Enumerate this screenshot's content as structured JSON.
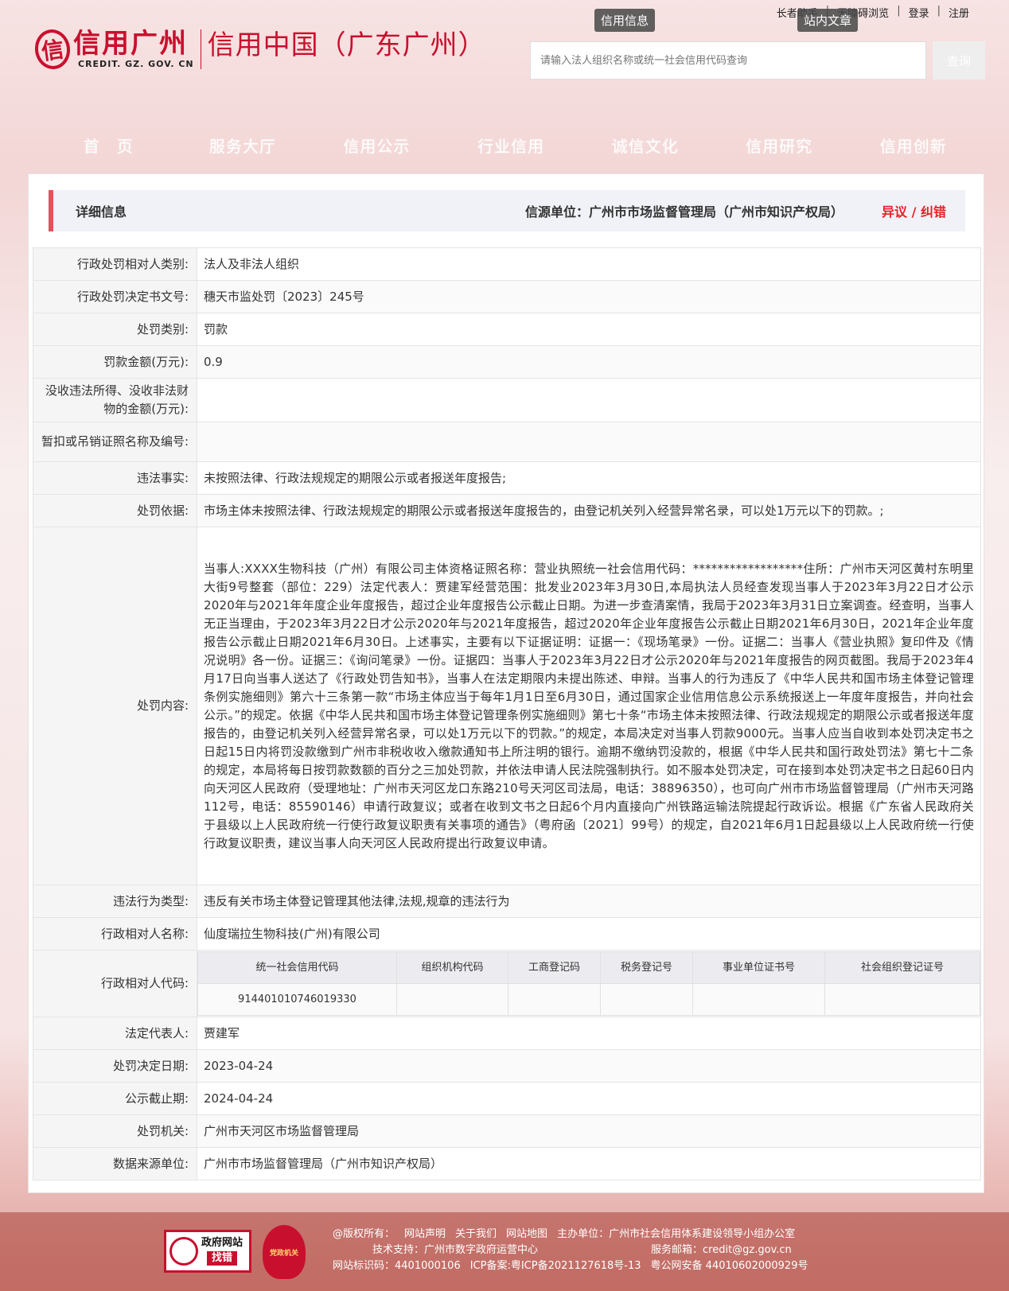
{
  "header": {
    "logo_cn": "信用广州",
    "logo_en": "CREDIT. GZ. GOV. CN",
    "site_title": "信用中国（广东广州）",
    "top_links": [
      "长者助手",
      "无障碍浏览",
      "登录",
      "注册"
    ],
    "tab_credit_info": "信用信息",
    "tab_site_article": "站内文章",
    "search_placeholder": "请输入法人组织名称或统一社会信用代码查询",
    "search_button": "查询"
  },
  "nav": [
    "首　页",
    "服务大厅",
    "信用公示",
    "行业信用",
    "诚信文化",
    "信用研究",
    "信用创新"
  ],
  "detail": {
    "title": "详细信息",
    "source": "信源单位：广州市市场监督管理局（广州市知识产权局）",
    "objection": "异议 / 纠错"
  },
  "rows": {
    "subject_type": {
      "label": "行政处罚相对人类别:",
      "value": "法人及非法人组织"
    },
    "doc_no": {
      "label": "行政处罚决定书文号:",
      "value": "穗天市监处罚〔2023〕245号"
    },
    "penalty_type": {
      "label": "处罚类别:",
      "value": "罚款"
    },
    "amount": {
      "label": "罚款金额(万元):",
      "value": "0.9"
    },
    "confiscate": {
      "label": "没收违法所得、没收非法财物的金额(万元):",
      "value": ""
    },
    "license": {
      "label": "暂扣或吊销证照名称及编号:",
      "value": ""
    },
    "facts": {
      "label": "违法事实:",
      "value": "未按照法律、行政法规规定的期限公示或者报送年度报告;"
    },
    "basis": {
      "label": "处罚依据:",
      "value": "市场主体未按照法律、行政法规规定的期限公示或者报送年度报告的，由登记机关列入经营异常名录，可以处1万元以下的罚款。;"
    },
    "content": {
      "label": "处罚内容:",
      "value": "当事人:XXXX生物科技（广州）有限公司主体资格证照名称：营业执照统一社会信用代码：******************住所：广州市天河区黄村东明里大街9号整套（部位：229）法定代表人：贾建军经营范围：批发业2023年3月30日,本局执法人员经查发现当事人于2023年3月22日才公示2020年与2021年年度企业年度报告，超过企业年度报告公示截止日期。为进一步查清案情，我局于2023年3月31日立案调查。经查明，当事人无正当理由，于2023年3月22日才公示2020年与2021年度报告，超过2020年企业年度报告公示截止日期2021年6月30日，2021年企业年度报告公示截止日期2021年6月30日。上述事实，主要有以下证据证明：证据一：《现场笔录》一份。证据二：当事人《营业执照》复印件及《情况说明》各一份。证据三：《询问笔录》一份。证据四：当事人于2023年3月22日才公示2020年与2021年度报告的网页截图。我局于2023年4月17日向当事人送达了《行政处罚告知书》，当事人在法定期限内未提出陈述、申辩。当事人的行为违反了《中华人民共和国市场主体登记管理条例实施细则》第六十三条第一款“市场主体应当于每年1月1日至6月30日，通过国家企业信用信息公示系统报送上一年度年度报告，并向社会公示。”的规定。依据《中华人民共和国市场主体登记管理条例实施细则》第七十条“市场主体未按照法律、行政法规规定的期限公示或者报送年度报告的，由登记机关列入经营异常名录，可以处1万元以下的罚款。”的规定，本局决定对当事人罚款9000元。当事人应当自收到本处罚决定书之日起15日内将罚没款缴到广州市非税收收入缴款通知书上所注明的银行。逾期不缴纳罚没款的，根据《中华人民共和国行政处罚法》第七十二条的规定，本局将每日按罚款数额的百分之三加处罚款，并依法申请人民法院强制执行。如不服本处罚决定，可在接到本处罚决定书之日起60日内向天河区人民政府（受理地址：广州市天河区龙口东路210号天河区司法局，电话：38896350），也可向广州市市场监督管理局（广州市天河路112号，电话：85590146）申请行政复议；或者在收到文书之日起6个月内直接向广州铁路运输法院提起行政诉讼。根据《广东省人民政府关于县级以上人民政府统一行使行政复议职责有关事项的通告》（粤府函〔2021〕99号）的规定，自2021年6月1日起县级以上人民政府统一行使行政复议职责，建议当事人向天河区人民政府提出行政复议申请。"
    },
    "violation_type": {
      "label": "违法行为类型:",
      "value": "违反有关市场主体登记管理其他法律,法规,规章的违法行为"
    },
    "subject_name": {
      "label": "行政相对人名称:",
      "value": "仙度瑞拉生物科技(广州)有限公司"
    },
    "subject_code": {
      "label": "行政相对人代码:"
    },
    "legal_rep": {
      "label": "法定代表人:",
      "value": "贾建军"
    },
    "decision_date": {
      "label": "处罚决定日期:",
      "value": "2023-04-24"
    },
    "publish_end": {
      "label": "公示截止期:",
      "value": "2024-04-24"
    },
    "authority": {
      "label": "处罚机关:",
      "value": "广州市天河区市场监督管理局"
    },
    "data_source": {
      "label": "数据来源单位:",
      "value": "广州市市场监督管理局（广州市知识产权局）"
    }
  },
  "codes": {
    "headers": [
      "统一社会信用代码",
      "组织机构代码",
      "工商登记码",
      "税务登记号",
      "事业单位证书号",
      "社会组织登记证号"
    ],
    "values": [
      "914401010746019330",
      "",
      "",
      "",
      "",
      ""
    ]
  },
  "footer": {
    "gov_box_top": "政府网站",
    "gov_box_bottom": "找错",
    "party_badge": "党政机关",
    "line1": [
      "@版权所有：",
      "网站声明",
      "关于我们",
      "网站地图",
      "主办单位：广州市社会信用体系建设领导小组办公室"
    ],
    "line2": [
      "技术支持：广州市数字政府运营中心",
      "服务邮箱：credit@gz.gov.cn"
    ],
    "line3": [
      "网站标识码：4401000106",
      "ICP备案:粤ICP备2021127618号-13",
      "粤公网安备 44010602000929号"
    ]
  },
  "colors": {
    "accent": "#c8102e",
    "objection": "#e62129",
    "head_bar": "#e8505b"
  }
}
